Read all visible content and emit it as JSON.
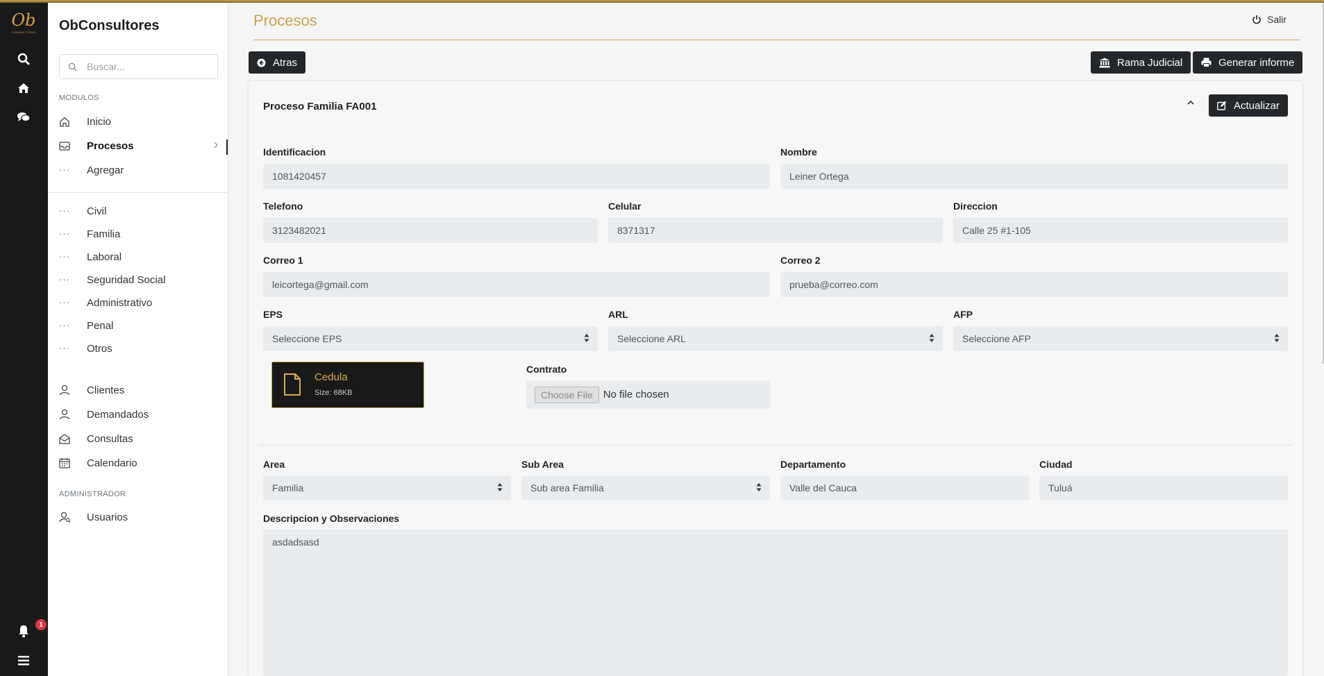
{
  "app": {
    "brand": "ObConsultores",
    "logo_text": "Ob",
    "logo_subtext": "CONSULTORES",
    "notification_count": "1"
  },
  "sidebar": {
    "search_placeholder": "Buscar...",
    "modules_label": "MODULOS",
    "admin_label": "ADMINISTRADOR",
    "items": {
      "inicio": "Inicio",
      "procesos": "Procesos",
      "agregar": "Agregar",
      "civil": "Civil",
      "familia": "Familia",
      "laboral": "Laboral",
      "seguridad_social": "Seguridad Social",
      "administrativo": "Administrativo",
      "penal": "Penal",
      "otros": "Otros",
      "clientes": "Clientes",
      "demandados": "Demandados",
      "consultas": "Consultas",
      "calendario": "Calendario",
      "usuarios": "Usuarios"
    }
  },
  "header": {
    "title": "Procesos",
    "logout": "Salir"
  },
  "toolbar": {
    "back": "Atras",
    "rama_judicial": "Rama Judicial",
    "generar_informe": "Generar informe"
  },
  "card": {
    "title": "Proceso Familia FA001",
    "update": "Actualizar"
  },
  "form": {
    "identificacion": {
      "label": "Identificacion",
      "value": "1081420457"
    },
    "nombre": {
      "label": "Nombre",
      "value": "Leiner Ortega"
    },
    "telefono": {
      "label": "Telefono",
      "value": "3123482021"
    },
    "celular": {
      "label": "Celular",
      "value": "8371317"
    },
    "direccion": {
      "label": "Direccion",
      "value": "Calle 25 #1-105"
    },
    "correo1": {
      "label": "Correo 1",
      "value": "leicortega@gmail.com"
    },
    "correo2": {
      "label": "Correo 2",
      "value": "prueba@correo.com"
    },
    "eps": {
      "label": "EPS",
      "value": "Seleccione EPS"
    },
    "arl": {
      "label": "ARL",
      "value": "Seleccione ARL"
    },
    "afp": {
      "label": "AFP",
      "value": "Seleccione AFP"
    },
    "cedula_file": {
      "name": "Cedula",
      "size": "Size: 68KB"
    },
    "contrato": {
      "label": "Contrato",
      "choose": "Choose File",
      "status": "No file chosen"
    },
    "area": {
      "label": "Area",
      "value": "Familia"
    },
    "sub_area": {
      "label": "Sub Area",
      "value": "Sub area Familia"
    },
    "departamento": {
      "label": "Departamento",
      "value": "Valle del Cauca"
    },
    "ciudad": {
      "label": "Ciudad",
      "value": "Tuluá"
    },
    "descripcion": {
      "label": "Descripcion y Observaciones",
      "value": "asdadsasd"
    }
  },
  "colors": {
    "accent": "#caa253",
    "dark": "#191919",
    "button": "#23272b",
    "field": "#e9ecef",
    "badge": "#dc3545"
  }
}
